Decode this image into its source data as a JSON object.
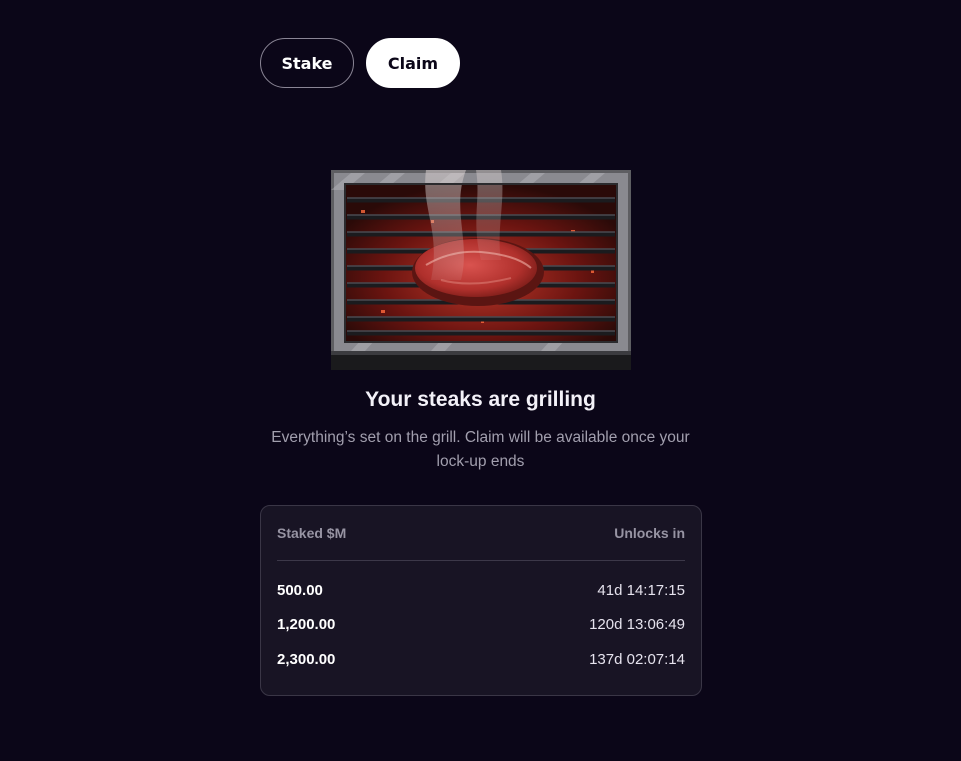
{
  "tabs": {
    "stake_label": "Stake",
    "claim_label": "Claim",
    "active": "Claim"
  },
  "hero": {
    "image_icon": "grilling-steak-illustration",
    "title": "Your steaks are grilling",
    "subtitle": "Everything’s set on the grill. Claim will be available once your lock-up ends"
  },
  "table": {
    "col_amount": "Staked $M",
    "col_unlock": "Unlocks in",
    "rows": [
      {
        "amount": "500.00",
        "unlocks_in": "41d 14:17:15"
      },
      {
        "amount": "1,200.00",
        "unlocks_in": "120d 13:06:49"
      },
      {
        "amount": "2,300.00",
        "unlocks_in": "137d 02:07:14"
      }
    ]
  },
  "colors": {
    "background": "#0b0618",
    "card": "#181424",
    "accent": "#ffffff"
  }
}
